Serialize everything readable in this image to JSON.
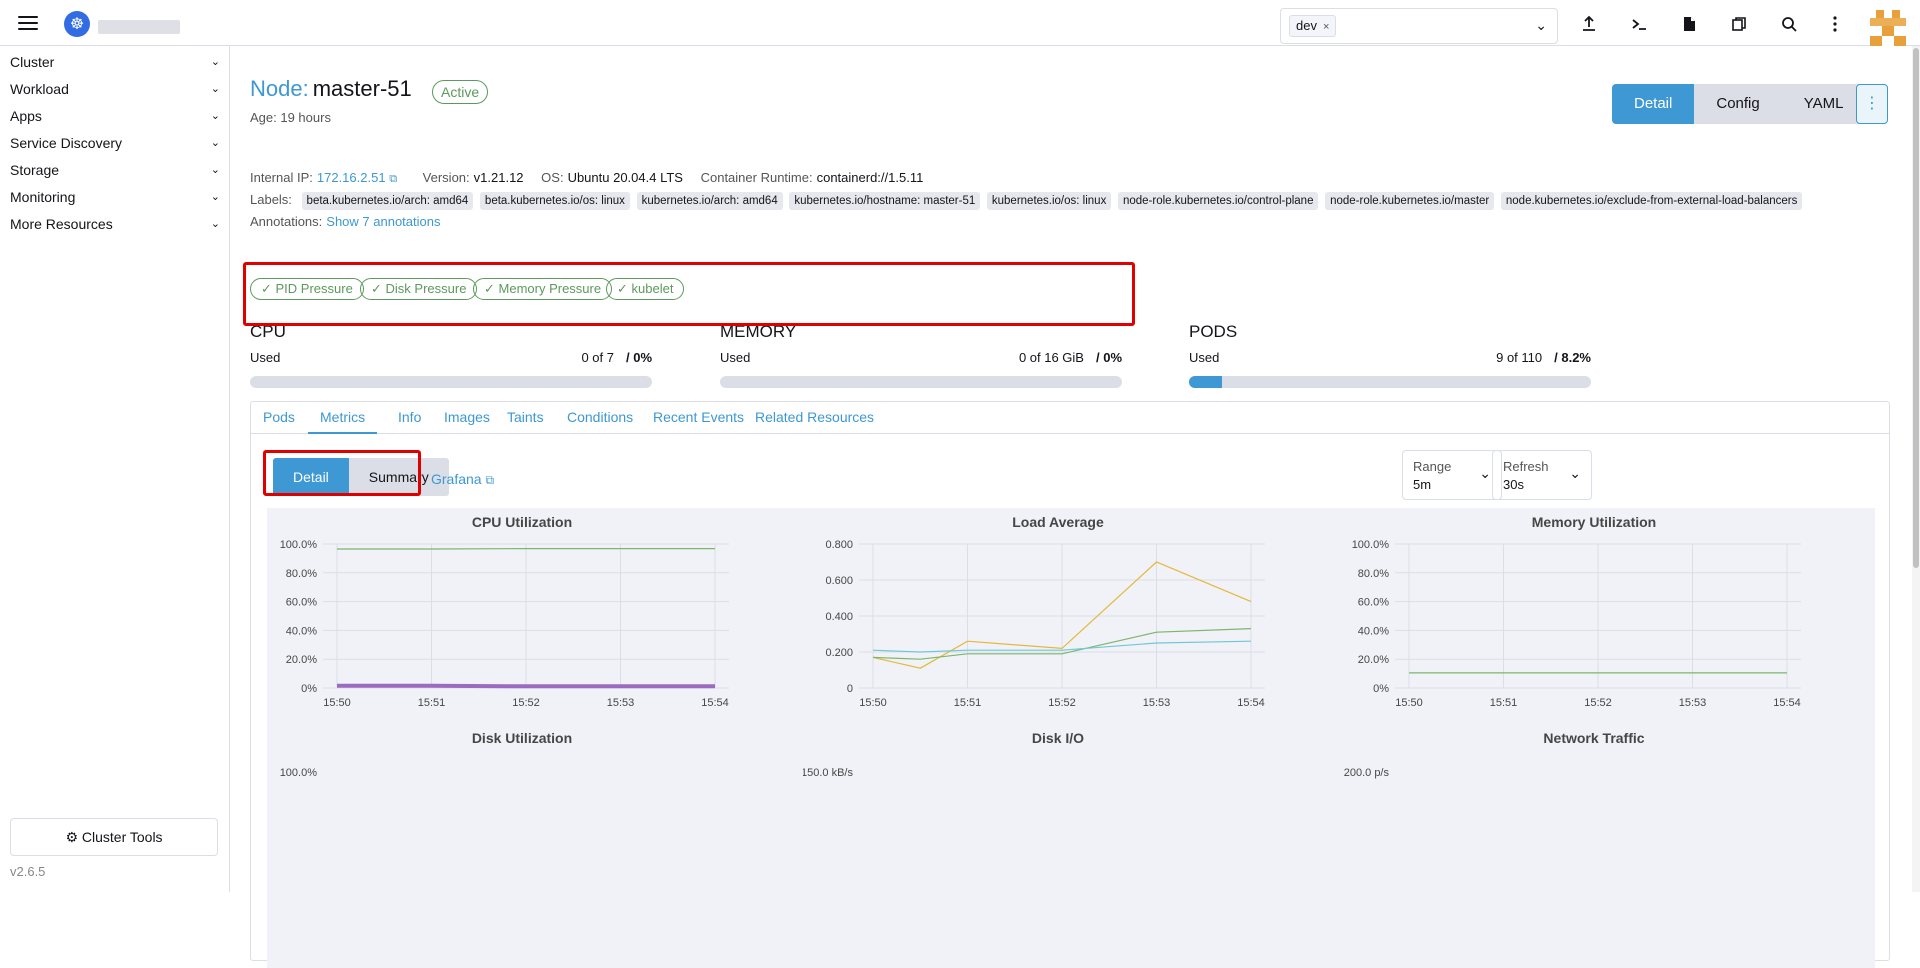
{
  "topbar": {
    "namespace_chip": "dev",
    "namespace_chip_remove": "×",
    "icons": [
      "upload-icon",
      "terminal-icon",
      "file-icon",
      "copy-icon",
      "search-icon",
      "kebab-icon"
    ]
  },
  "sidebar": {
    "items": [
      {
        "label": "Cluster"
      },
      {
        "label": "Workload"
      },
      {
        "label": "Apps"
      },
      {
        "label": "Service Discovery"
      },
      {
        "label": "Storage"
      },
      {
        "label": "Monitoring"
      },
      {
        "label": "More Resources"
      }
    ],
    "cluster_tools": "Cluster Tools",
    "version": "v2.6.5"
  },
  "header": {
    "kind": "Node:",
    "name": "master-51",
    "status": "Active",
    "age": "Age: 19 hours",
    "view_buttons": [
      "Detail",
      "Config",
      "YAML"
    ],
    "active_view": "Detail"
  },
  "meta": {
    "internal_ip_label": "Internal IP:",
    "internal_ip": "172.16.2.51",
    "version_label": "Version:",
    "version": "v1.21.12",
    "os_label": "OS:",
    "os": "Ubuntu 20.04.4 LTS",
    "runtime_label": "Container Runtime:",
    "runtime": "containerd://1.5.11",
    "labels_label": "Labels:",
    "labels": [
      "beta.kubernetes.io/arch: amd64",
      "beta.kubernetes.io/os: linux",
      "kubernetes.io/arch: amd64",
      "kubernetes.io/hostname: master-51",
      "kubernetes.io/os: linux",
      "node-role.kubernetes.io/control-plane",
      "node-role.kubernetes.io/master",
      "node.kubernetes.io/exclude-from-external-load-balancers"
    ],
    "annotations_label": "Annotations:",
    "annotations_link": "Show 7 annotations"
  },
  "conditions": [
    "PID Pressure",
    "Disk Pressure",
    "Memory Pressure",
    "kubelet"
  ],
  "gauges": {
    "cpu": {
      "title": "CPU",
      "used_label": "Used",
      "value": "0 of 7",
      "percent": "/ 0%",
      "fraction": 0
    },
    "memory": {
      "title": "MEMORY",
      "used_label": "Used",
      "value": "0 of 16 GiB",
      "percent": "/ 0%",
      "fraction": 0
    },
    "pods": {
      "title": "PODS",
      "used_label": "Used",
      "value": "9 of 110",
      "percent": "/ 8.2%",
      "fraction": 0.082
    }
  },
  "tabs": [
    "Pods",
    "Metrics",
    "Info",
    "Images",
    "Taints",
    "Conditions",
    "Recent Events",
    "Related Resources"
  ],
  "active_tab": "Metrics",
  "metrics": {
    "segments": [
      "Detail",
      "Summary"
    ],
    "active_segment": "Detail",
    "grafana_link": "Grafana",
    "range_label": "Range",
    "range_value": "5m",
    "refresh_label": "Refresh",
    "refresh_value": "30s"
  },
  "colors": {
    "accent": "#3d98d3",
    "success": "#5d995d",
    "highlight": "#e00000",
    "series_green": "#7cb56c",
    "series_yellow": "#e5b83a",
    "series_cyan": "#6fc7d9",
    "series_purple": "#9c6bbf"
  },
  "chart_data": [
    {
      "type": "line",
      "title": "CPU Utilization",
      "x": [
        "15:50",
        "15:51",
        "15:52",
        "15:53",
        "15:54"
      ],
      "y_ticks": [
        "100.0%",
        "80.0%",
        "60.0%",
        "40.0%",
        "20.0%",
        "0%"
      ],
      "ylim": [
        0,
        100
      ],
      "series": [
        {
          "color": "#7cb56c",
          "values": [
            96.5,
            96.5,
            96.8,
            96.8,
            96.8
          ]
        },
        {
          "color": "#9c6bbf",
          "values": [
            1.5,
            1.5,
            1.2,
            1.2,
            1.2
          ]
        }
      ]
    },
    {
      "type": "line",
      "title": "Load Average",
      "x": [
        "15:50",
        "15:51",
        "15:52",
        "15:53",
        "15:54"
      ],
      "y_ticks": [
        "0.800",
        "0.600",
        "0.400",
        "0.200",
        "0"
      ],
      "ylim": [
        0,
        0.8
      ],
      "series": [
        {
          "color": "#e5b83a",
          "x_index": [
            0,
            0.5,
            1,
            2,
            3,
            4
          ],
          "values": [
            0.17,
            0.11,
            0.26,
            0.22,
            0.7,
            0.48
          ]
        },
        {
          "color": "#7cb56c",
          "x_index": [
            0,
            0.5,
            1,
            2,
            3,
            4
          ],
          "values": [
            0.17,
            0.16,
            0.19,
            0.19,
            0.31,
            0.33
          ]
        },
        {
          "color": "#6fc7d9",
          "x_index": [
            0,
            0.5,
            1,
            2,
            3,
            4
          ],
          "values": [
            0.21,
            0.2,
            0.21,
            0.21,
            0.25,
            0.26
          ]
        }
      ]
    },
    {
      "type": "line",
      "title": "Memory Utilization",
      "x": [
        "15:50",
        "15:51",
        "15:52",
        "15:53",
        "15:54"
      ],
      "y_ticks": [
        "100.0%",
        "80.0%",
        "60.0%",
        "40.0%",
        "20.0%",
        "0%"
      ],
      "ylim": [
        0,
        100
      ],
      "series": [
        {
          "color": "#7cb56c",
          "values": [
            10.5,
            10.5,
            10.5,
            10.5,
            10.5
          ]
        }
      ]
    },
    {
      "type": "line",
      "title": "Disk Utilization",
      "y_ticks": [
        "100.0%"
      ]
    },
    {
      "type": "line",
      "title": "Disk I/O",
      "y_ticks": [
        "150.0 kB/s"
      ]
    },
    {
      "type": "line",
      "title": "Network Traffic",
      "y_ticks": [
        "200.0 p/s"
      ]
    }
  ]
}
